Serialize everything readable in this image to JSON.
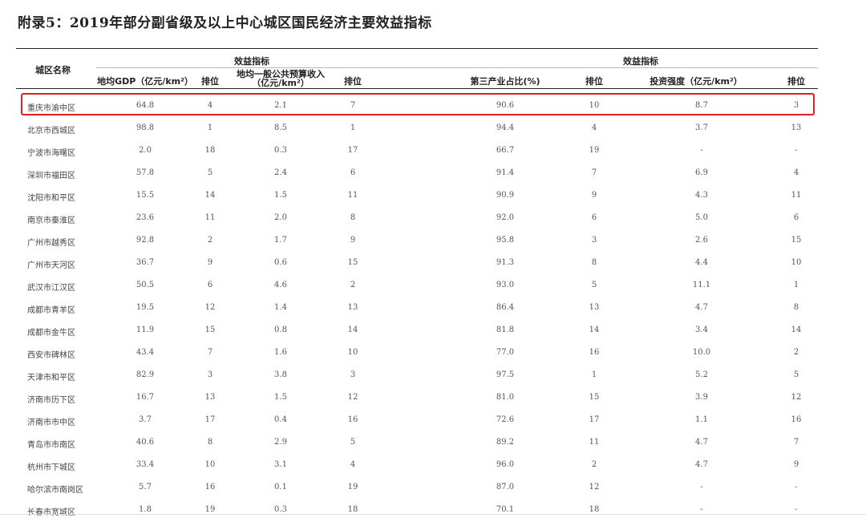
{
  "title": "附录5：2019年部分副省级及以上中心城区国民经济主要效益指标",
  "header": {
    "name_col": "城区名称",
    "group_left": "效益指标",
    "group_right": "效益指标",
    "cols": [
      "地均GDP（亿元/km²）",
      "排位",
      "地均一般公共预算收入",
      "（亿元/km²）",
      "排位",
      "第三产业占比(%)",
      "排位",
      "投资强度（亿元/km²）",
      "排位"
    ]
  },
  "rows": [
    [
      "重庆市渝中区",
      "64.8",
      "4",
      "2.1",
      "7",
      "90.6",
      "10",
      "8.7",
      "3"
    ],
    [
      "北京市西城区",
      "98.8",
      "1",
      "8.5",
      "1",
      "94.4",
      "4",
      "3.7",
      "13"
    ],
    [
      "宁波市海曙区",
      "2.0",
      "18",
      "0.3",
      "17",
      "66.7",
      "19",
      "-",
      "-"
    ],
    [
      "深圳市福田区",
      "57.8",
      "5",
      "2.4",
      "6",
      "91.4",
      "7",
      "6.9",
      "4"
    ],
    [
      "沈阳市和平区",
      "15.5",
      "14",
      "1.5",
      "11",
      "90.9",
      "9",
      "4.3",
      "11"
    ],
    [
      "南京市秦淮区",
      "23.6",
      "11",
      "2.0",
      "8",
      "92.0",
      "6",
      "5.0",
      "6"
    ],
    [
      "广州市越秀区",
      "92.8",
      "2",
      "1.7",
      "9",
      "95.8",
      "3",
      "2.6",
      "15"
    ],
    [
      "广州市天河区",
      "36.7",
      "9",
      "0.6",
      "15",
      "91.3",
      "8",
      "4.4",
      "10"
    ],
    [
      "武汉市江汉区",
      "50.5",
      "6",
      "4.6",
      "2",
      "93.0",
      "5",
      "11.1",
      "1"
    ],
    [
      "成都市青羊区",
      "19.5",
      "12",
      "1.4",
      "13",
      "86.4",
      "13",
      "4.7",
      "8"
    ],
    [
      "成都市金牛区",
      "11.9",
      "15",
      "0.8",
      "14",
      "81.8",
      "14",
      "3.4",
      "14"
    ],
    [
      "西安市碑林区",
      "43.4",
      "7",
      "1.6",
      "10",
      "77.0",
      "16",
      "10.0",
      "2"
    ],
    [
      "天津市和平区",
      "82.9",
      "3",
      "3.8",
      "3",
      "97.5",
      "1",
      "5.2",
      "5"
    ],
    [
      "济南市历下区",
      "16.7",
      "13",
      "1.5",
      "12",
      "81.0",
      "15",
      "3.9",
      "12"
    ],
    [
      "济南市市中区",
      "3.7",
      "17",
      "0.4",
      "16",
      "72.6",
      "17",
      "1.1",
      "16"
    ],
    [
      "青岛市市南区",
      "40.6",
      "8",
      "2.9",
      "5",
      "89.2",
      "11",
      "4.7",
      "7"
    ],
    [
      "杭州市下城区",
      "33.4",
      "10",
      "3.1",
      "4",
      "96.0",
      "2",
      "4.7",
      "9"
    ],
    [
      "哈尔滨市南岗区",
      "5.7",
      "16",
      "0.1",
      "19",
      "87.0",
      "12",
      "-",
      "-"
    ],
    [
      "长春市宽城区",
      "1.8",
      "19",
      "0.3",
      "18",
      "70.1",
      "18",
      "-",
      "-"
    ]
  ],
  "colors": {
    "highlight": "#e02020"
  }
}
